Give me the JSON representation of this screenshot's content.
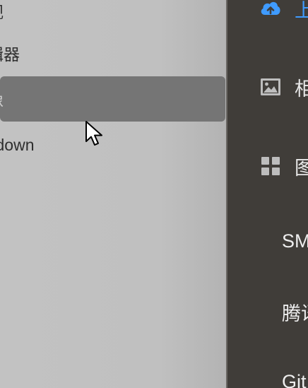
{
  "context_menu": {
    "items": [
      {
        "label": "视"
      },
      {
        "label": "辑器"
      },
      {
        "label": "像"
      },
      {
        "label": "kdown"
      }
    ]
  },
  "side_nav": {
    "items": [
      {
        "label": "上",
        "icon": "cloud-upload-icon",
        "color": "#3f9bff"
      },
      {
        "label": "相",
        "icon": "image-icon"
      },
      {
        "label": "图",
        "icon": "grid-icon"
      }
    ],
    "sub_items": [
      {
        "label": "SM"
      },
      {
        "label": "腾讯"
      },
      {
        "label": "Git"
      }
    ]
  },
  "colors": {
    "menu_background": "#c0c0c0",
    "menu_highlight": "#757575",
    "panel_background": "#403d39",
    "accent": "#3f9bff"
  }
}
